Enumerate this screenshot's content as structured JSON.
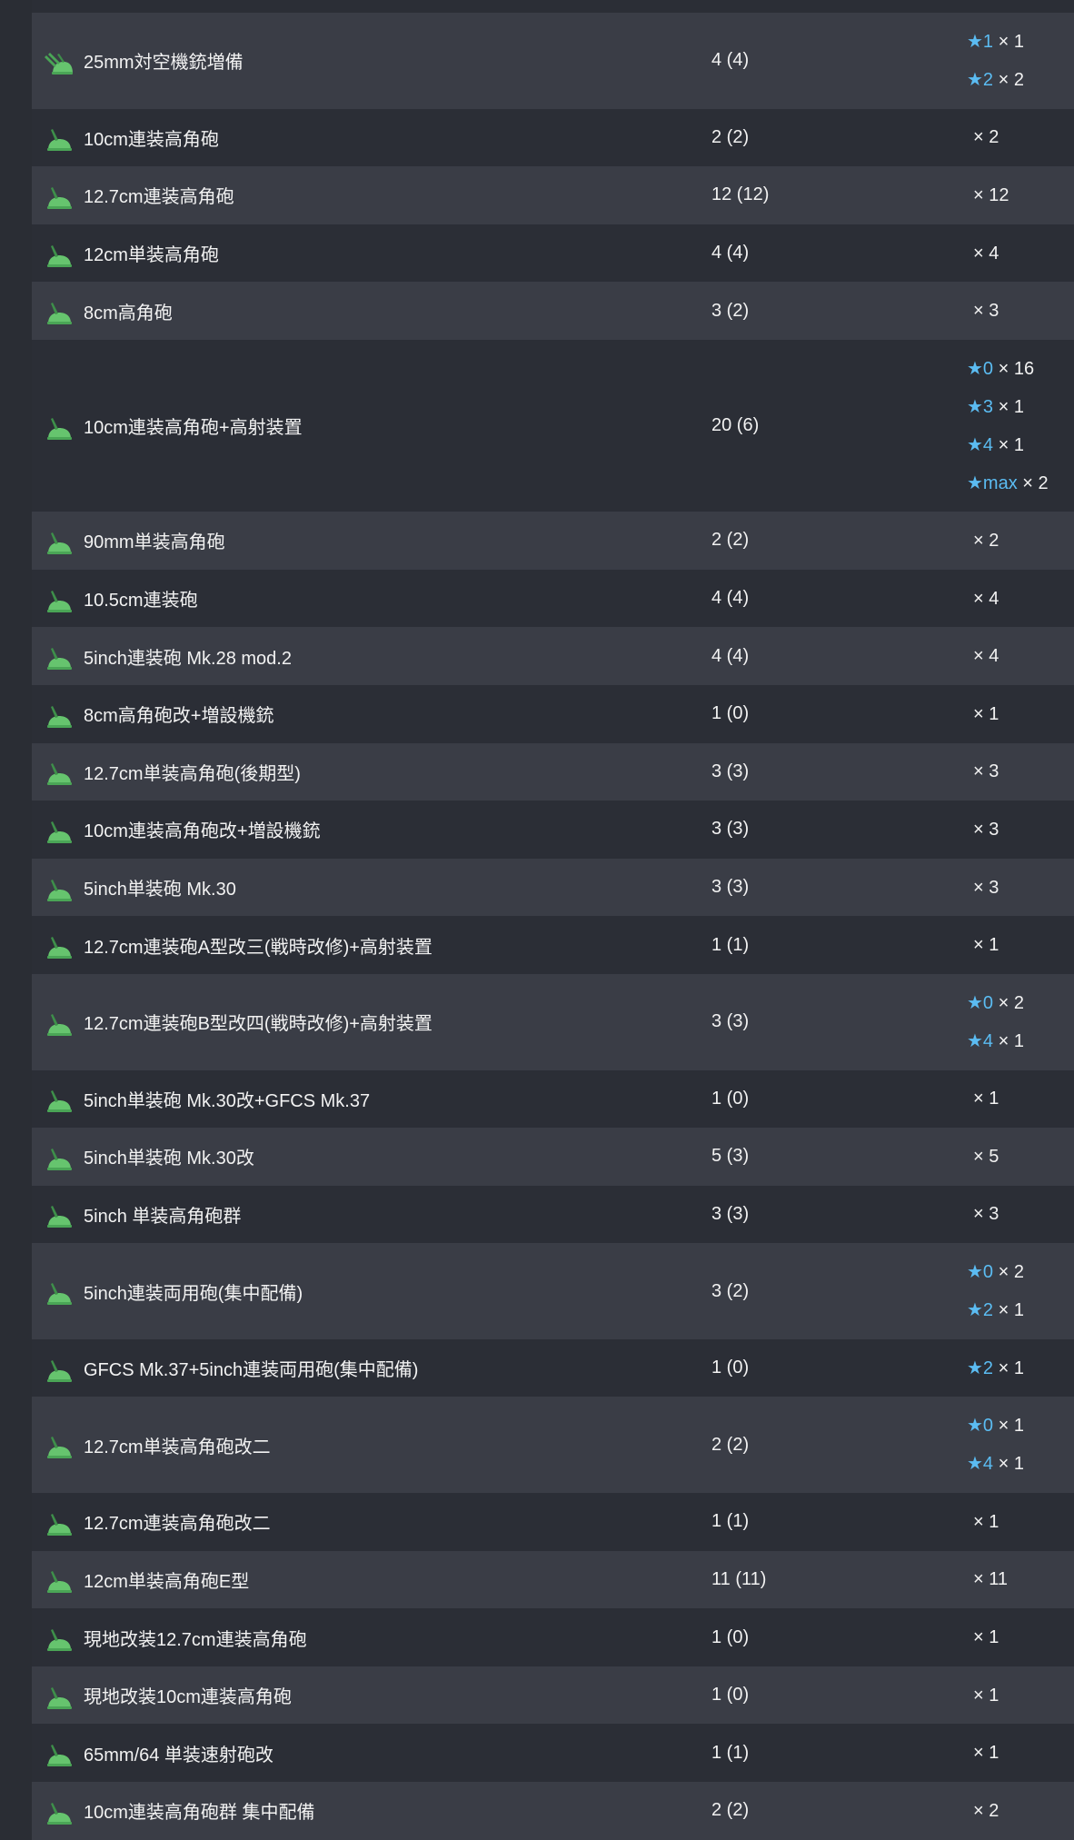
{
  "icon": "aa-gun-icon",
  "colors": {
    "row_light": "#3a3d46",
    "row_dark": "#2b2e36",
    "star": "#5bbcf2",
    "icon_green": "#66c46e"
  },
  "rows": [
    {
      "name": "25mm対空機銃増備",
      "count": "4 (4)",
      "icon": "aa-machine-gun-icon",
      "stars": [
        {
          "level": "★1",
          "qty": "× 1"
        },
        {
          "level": "★2",
          "qty": "× 2"
        }
      ]
    },
    {
      "name": "10cm連装高角砲",
      "count": "2 (2)",
      "icon": "aa-gun-icon",
      "stars": [
        {
          "level": "",
          "qty": "× 2"
        }
      ]
    },
    {
      "name": "12.7cm連装高角砲",
      "count": "12 (12)",
      "icon": "aa-gun-icon",
      "stars": [
        {
          "level": "",
          "qty": "× 12"
        }
      ]
    },
    {
      "name": "12cm単装高角砲",
      "count": "4 (4)",
      "icon": "aa-gun-icon",
      "stars": [
        {
          "level": "",
          "qty": "× 4"
        }
      ]
    },
    {
      "name": "8cm高角砲",
      "count": "3 (2)",
      "icon": "aa-gun-icon",
      "stars": [
        {
          "level": "",
          "qty": "× 3"
        }
      ]
    },
    {
      "name": "10cm連装高角砲+高射装置",
      "count": "20 (6)",
      "icon": "aa-gun-icon",
      "stars": [
        {
          "level": "★0",
          "qty": "× 16"
        },
        {
          "level": "★3",
          "qty": "× 1"
        },
        {
          "level": "★4",
          "qty": "× 1"
        },
        {
          "level": "★max",
          "qty": "× 2"
        }
      ]
    },
    {
      "name": "90mm単装高角砲",
      "count": "2 (2)",
      "icon": "aa-gun-icon",
      "stars": [
        {
          "level": "",
          "qty": "× 2"
        }
      ]
    },
    {
      "name": "10.5cm連装砲",
      "count": "4 (4)",
      "icon": "aa-gun-icon",
      "stars": [
        {
          "level": "",
          "qty": "× 4"
        }
      ]
    },
    {
      "name": "5inch連装砲 Mk.28 mod.2",
      "count": "4 (4)",
      "icon": "aa-gun-icon",
      "stars": [
        {
          "level": "",
          "qty": "× 4"
        }
      ]
    },
    {
      "name": "8cm高角砲改+増設機銃",
      "count": "1 (0)",
      "icon": "aa-gun-icon",
      "stars": [
        {
          "level": "",
          "qty": "× 1"
        }
      ]
    },
    {
      "name": "12.7cm単装高角砲(後期型)",
      "count": "3 (3)",
      "icon": "aa-gun-icon",
      "stars": [
        {
          "level": "",
          "qty": "× 3"
        }
      ]
    },
    {
      "name": "10cm連装高角砲改+増設機銃",
      "count": "3 (3)",
      "icon": "aa-gun-icon",
      "stars": [
        {
          "level": "",
          "qty": "× 3"
        }
      ]
    },
    {
      "name": "5inch単装砲 Mk.30",
      "count": "3 (3)",
      "icon": "aa-gun-icon",
      "stars": [
        {
          "level": "",
          "qty": "× 3"
        }
      ]
    },
    {
      "name": "12.7cm連装砲A型改三(戦時改修)+高射装置",
      "count": "1 (1)",
      "icon": "aa-gun-icon",
      "stars": [
        {
          "level": "",
          "qty": "× 1"
        }
      ]
    },
    {
      "name": "12.7cm連装砲B型改四(戦時改修)+高射装置",
      "count": "3 (3)",
      "icon": "aa-gun-icon",
      "stars": [
        {
          "level": "★0",
          "qty": "× 2"
        },
        {
          "level": "★4",
          "qty": "× 1"
        }
      ]
    },
    {
      "name": "5inch単装砲 Mk.30改+GFCS Mk.37",
      "count": "1 (0)",
      "icon": "aa-gun-icon",
      "stars": [
        {
          "level": "",
          "qty": "× 1"
        }
      ]
    },
    {
      "name": "5inch単装砲 Mk.30改",
      "count": "5 (3)",
      "icon": "aa-gun-icon",
      "stars": [
        {
          "level": "",
          "qty": "× 5"
        }
      ]
    },
    {
      "name": "5inch 単装高角砲群",
      "count": "3 (3)",
      "icon": "aa-gun-icon",
      "stars": [
        {
          "level": "",
          "qty": "× 3"
        }
      ]
    },
    {
      "name": "5inch連装両用砲(集中配備)",
      "count": "3 (2)",
      "icon": "aa-gun-icon",
      "stars": [
        {
          "level": "★0",
          "qty": "× 2"
        },
        {
          "level": "★2",
          "qty": "× 1"
        }
      ]
    },
    {
      "name": "GFCS Mk.37+5inch連装両用砲(集中配備)",
      "count": "1 (0)",
      "icon": "aa-gun-icon",
      "stars": [
        {
          "level": "★2",
          "qty": "× 1"
        }
      ]
    },
    {
      "name": "12.7cm単装高角砲改二",
      "count": "2 (2)",
      "icon": "aa-gun-icon",
      "stars": [
        {
          "level": "★0",
          "qty": "× 1"
        },
        {
          "level": "★4",
          "qty": "× 1"
        }
      ]
    },
    {
      "name": "12.7cm連装高角砲改二",
      "count": "1 (1)",
      "icon": "aa-gun-icon",
      "stars": [
        {
          "level": "",
          "qty": "× 1"
        }
      ]
    },
    {
      "name": "12cm単装高角砲E型",
      "count": "11 (11)",
      "icon": "aa-gun-icon",
      "stars": [
        {
          "level": "",
          "qty": "× 11"
        }
      ]
    },
    {
      "name": "現地改装12.7cm連装高角砲",
      "count": "1 (0)",
      "icon": "aa-gun-icon",
      "stars": [
        {
          "level": "",
          "qty": "× 1"
        }
      ]
    },
    {
      "name": "現地改装10cm連装高角砲",
      "count": "1 (0)",
      "icon": "aa-gun-icon",
      "stars": [
        {
          "level": "",
          "qty": "× 1"
        }
      ]
    },
    {
      "name": "65mm/64 単装速射砲改",
      "count": "1 (1)",
      "icon": "aa-gun-icon",
      "stars": [
        {
          "level": "",
          "qty": "× 1"
        }
      ]
    },
    {
      "name": "10cm連装高角砲群 集中配備",
      "count": "2 (2)",
      "icon": "aa-gun-icon",
      "stars": [
        {
          "level": "",
          "qty": "× 2"
        }
      ]
    }
  ]
}
